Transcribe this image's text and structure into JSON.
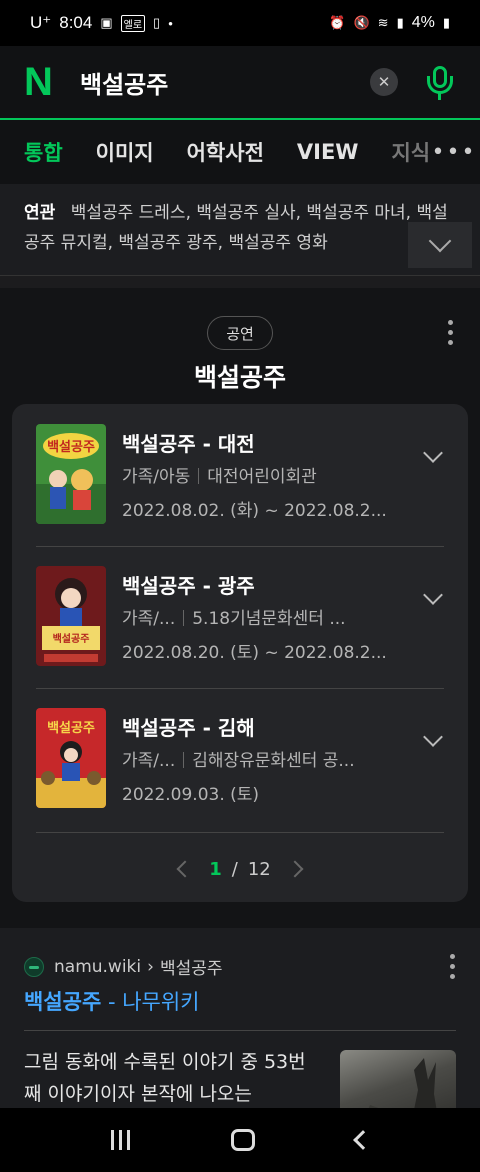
{
  "status_bar": {
    "carrier": "U⁺",
    "time": "8:04",
    "badge": "엘로",
    "battery": "4%"
  },
  "search": {
    "logo": "N",
    "query": "백설공주",
    "clear_icon": "close-icon",
    "mic_icon": "microphone-icon"
  },
  "tabs": [
    {
      "label": "통합",
      "active": true
    },
    {
      "label": "이미지"
    },
    {
      "label": "어학사전"
    },
    {
      "label": "VIEW"
    },
    {
      "label": "지식"
    }
  ],
  "tabs_more": "•••",
  "related": {
    "label": "연관",
    "text": "백설공주 드레스, 백설공주 실사, 백설공주 마녀, 백설공주 뮤지컬, 백설공주 광주, 백설공주 영화"
  },
  "performance": {
    "badge": "공연",
    "title": "백설공주",
    "items": [
      {
        "title": "백설공주 - 대전",
        "genre": "가족/아동",
        "venue": "대전어린이회관",
        "date": "2022.08.02. (화) ~ 2022.08.2...",
        "poster_top": "백설공주"
      },
      {
        "title": "백설공주 - 광주",
        "genre": "가족/...",
        "venue": "5.18기념문화센터 ...",
        "date": "2022.08.20. (토) ~ 2022.08.2...",
        "poster_top": "백설공주"
      },
      {
        "title": "백설공주 - 김해",
        "genre": "가족/...",
        "venue": "김해장유문화센터 공...",
        "date": "2022.09.03. (토)",
        "poster_top": "백설공주"
      }
    ],
    "pager": {
      "current": "1",
      "separator": "/",
      "total": "12"
    }
  },
  "web_result": {
    "site": "namu.wiki",
    "crumb_sep": "›",
    "crumb": "백설공주",
    "title_main": "백설공주",
    "title_rest": " - 나무위키",
    "snippet": "그림 동화에 수록된 이야기 중 53번째 이야기이자 본작에 나오는"
  },
  "colors": {
    "accent": "#03c75a",
    "link": "#45a7ff",
    "background": "#1c1c1e",
    "card": "#242528"
  }
}
